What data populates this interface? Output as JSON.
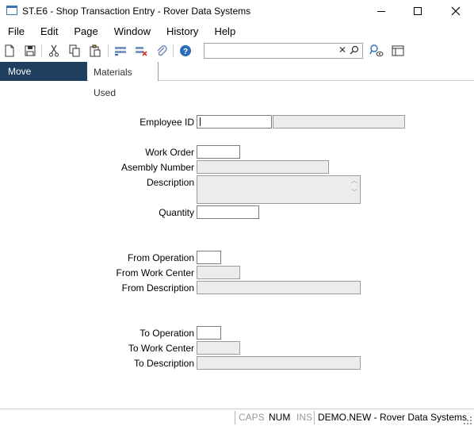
{
  "window": {
    "title": "ST.E6 - Shop Transaction Entry - Rover Data Systems"
  },
  "menu": {
    "items": [
      "File",
      "Edit",
      "Page",
      "Window",
      "History",
      "Help"
    ]
  },
  "toolbar": {
    "icons": [
      "new-document-icon",
      "save-icon",
      "cut-icon",
      "copy-icon",
      "paste-icon",
      "insert-row-icon",
      "delete-row-icon",
      "attach-icon",
      "help-icon",
      "search-clear-icon",
      "search-icon",
      "lookup-icon",
      "layout-icon"
    ],
    "search_value": ""
  },
  "tabs": [
    {
      "label": "Move Instructions",
      "active": true
    },
    {
      "label": "Materials Used",
      "active": false
    }
  ],
  "form": {
    "employee_id": {
      "label": "Employee ID",
      "value": "",
      "name_value": ""
    },
    "work_order": {
      "label": "Work Order",
      "value": ""
    },
    "assembly_number": {
      "label": "Asembly Number",
      "value": ""
    },
    "description": {
      "label": "Description",
      "value": ""
    },
    "quantity": {
      "label": "Quantity",
      "value": ""
    },
    "from_operation": {
      "label": "From Operation",
      "value": ""
    },
    "from_work_center": {
      "label": "From Work Center",
      "value": ""
    },
    "from_description": {
      "label": "From Description",
      "value": ""
    },
    "to_operation": {
      "label": "To Operation",
      "value": ""
    },
    "to_work_center": {
      "label": "To Work Center",
      "value": ""
    },
    "to_description": {
      "label": "To Description",
      "value": ""
    }
  },
  "statusbar": {
    "caps": "CAPS",
    "num": "NUM",
    "ins": "INS",
    "account": "DEMO.NEW - Rover Data Systems"
  },
  "colors": {
    "active_tab_bg": "#1e3f60",
    "readonly_field_bg": "#ececec",
    "status_inactive": "#9a9a9a",
    "accent_blue": "#2a6db8"
  }
}
